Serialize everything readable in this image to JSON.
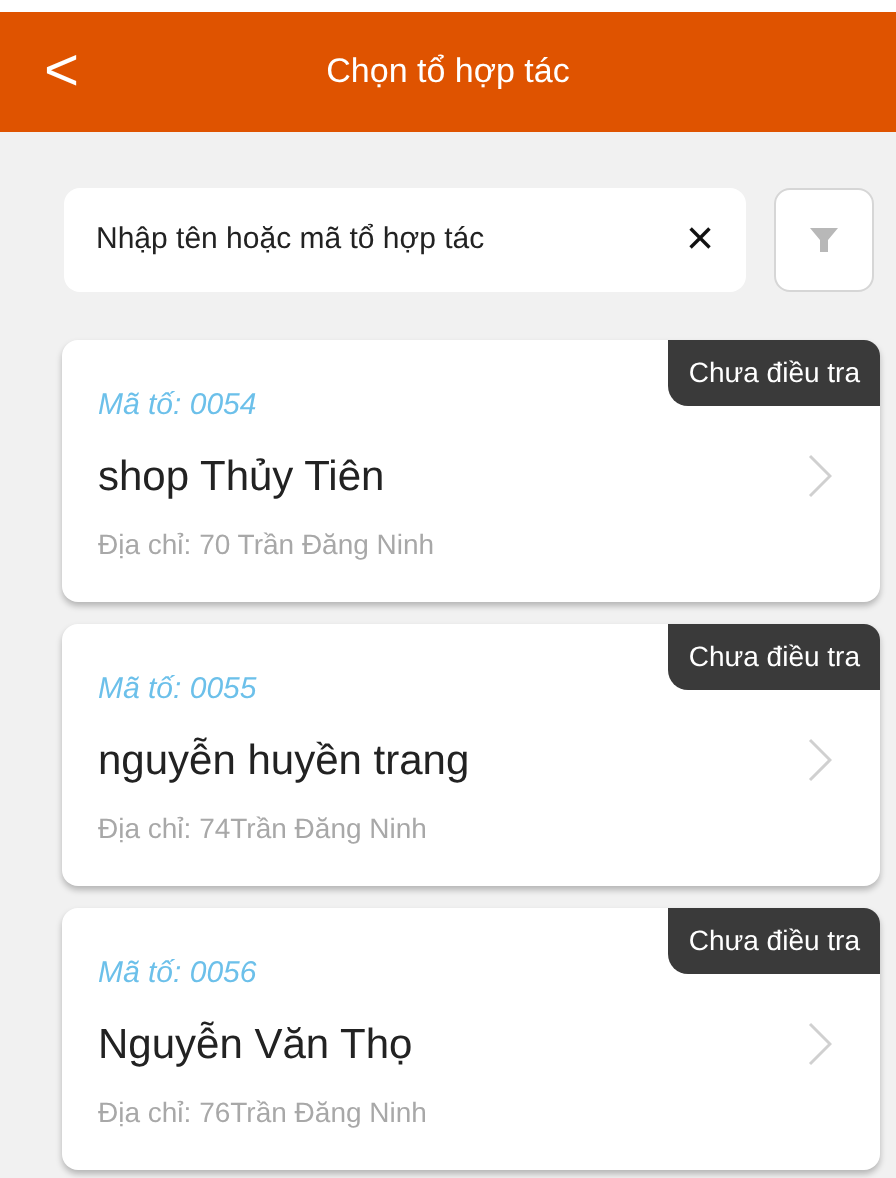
{
  "header": {
    "back": "<",
    "title": "Chọn tổ hợp tác"
  },
  "search": {
    "value": "Nhập tên hoặc mã tổ hợp tác",
    "clear": "×"
  },
  "items": [
    {
      "code": "Mã tố: 0054",
      "name": "shop Thủy Tiên",
      "address": "Địa chỉ: 70 Trần Đăng Ninh",
      "status": "Chưa điều tra"
    },
    {
      "code": "Mã tố: 0055",
      "name": "nguyễn huyền trang",
      "address": "Địa chỉ: 74Trần Đăng Ninh",
      "status": "Chưa điều tra"
    },
    {
      "code": "Mã tố: 0056",
      "name": "Nguyễn Văn Thọ",
      "address": "Địa chỉ: 76Trần Đăng Ninh",
      "status": "Chưa điều tra"
    }
  ]
}
